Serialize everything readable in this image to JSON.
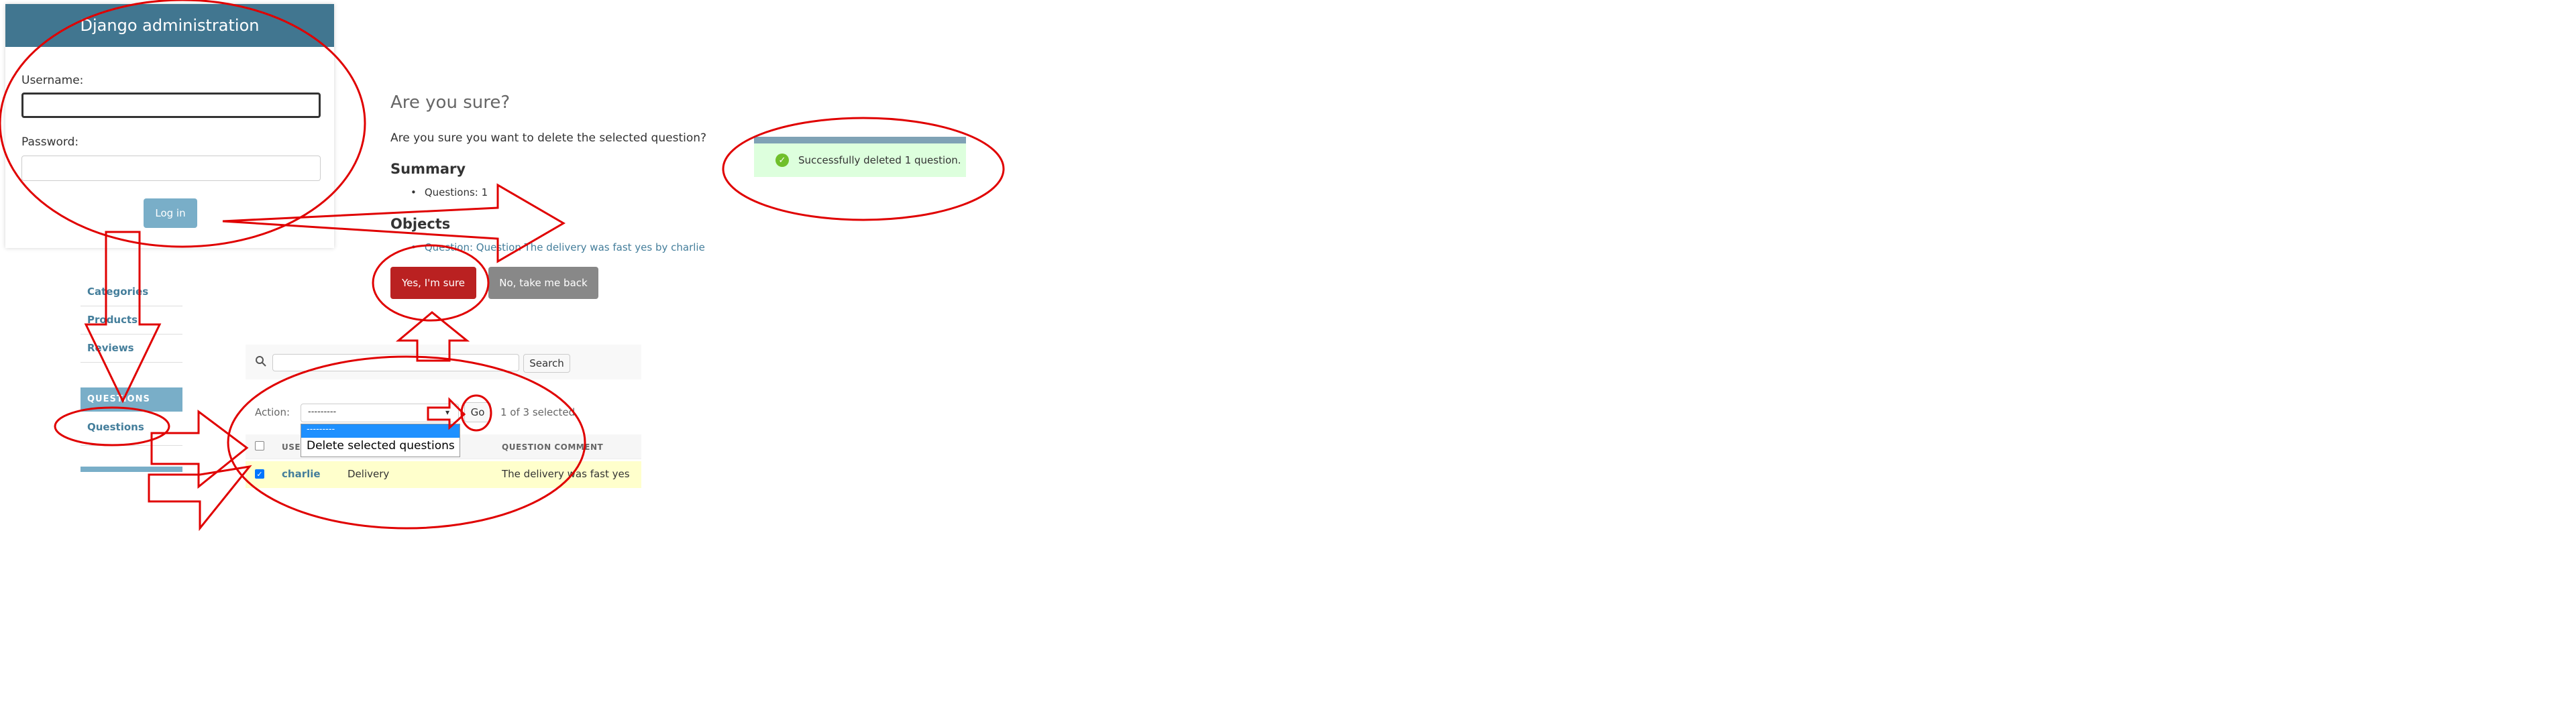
{
  "login": {
    "header": "Django administration",
    "username_label": "Username:",
    "password_label": "Password:",
    "login_button": "Log in"
  },
  "sidebar": {
    "items": [
      {
        "label": "Categories"
      },
      {
        "label": "Products"
      },
      {
        "label": "Reviews"
      }
    ],
    "section_caption": "QUESTIONS",
    "questions_link": "Questions"
  },
  "confirmation": {
    "title": "Are you sure?",
    "prompt": "Are you sure you want to delete the selected question? All o",
    "summary_heading": "Summary",
    "summary_item": "Questions: 1",
    "objects_heading": "Objects",
    "object_item": "Question: Question The delivery was fast yes by charlie",
    "yes_button": "Yes, I'm sure",
    "no_button": "No, take me back"
  },
  "success_message": "Successfully deleted 1 question.",
  "changelist": {
    "search_button": "Search",
    "action_label": "Action:",
    "action_selected": "---------",
    "dropdown_options": [
      "---------",
      "Delete selected questions"
    ],
    "go_button": "Go",
    "selection_count": "1 of 3 selected",
    "columns": [
      "USER",
      "QUESTION COMMENT"
    ],
    "row": {
      "user": "charlie",
      "category": "Delivery",
      "comment": "The delivery was fast yes",
      "checked": true
    }
  },
  "colors": {
    "header_blue": "#417690",
    "link_blue": "#447e9b",
    "danger_red": "#ba2121",
    "annotation_red": "#e00000",
    "success_bg": "#ddffdd"
  }
}
